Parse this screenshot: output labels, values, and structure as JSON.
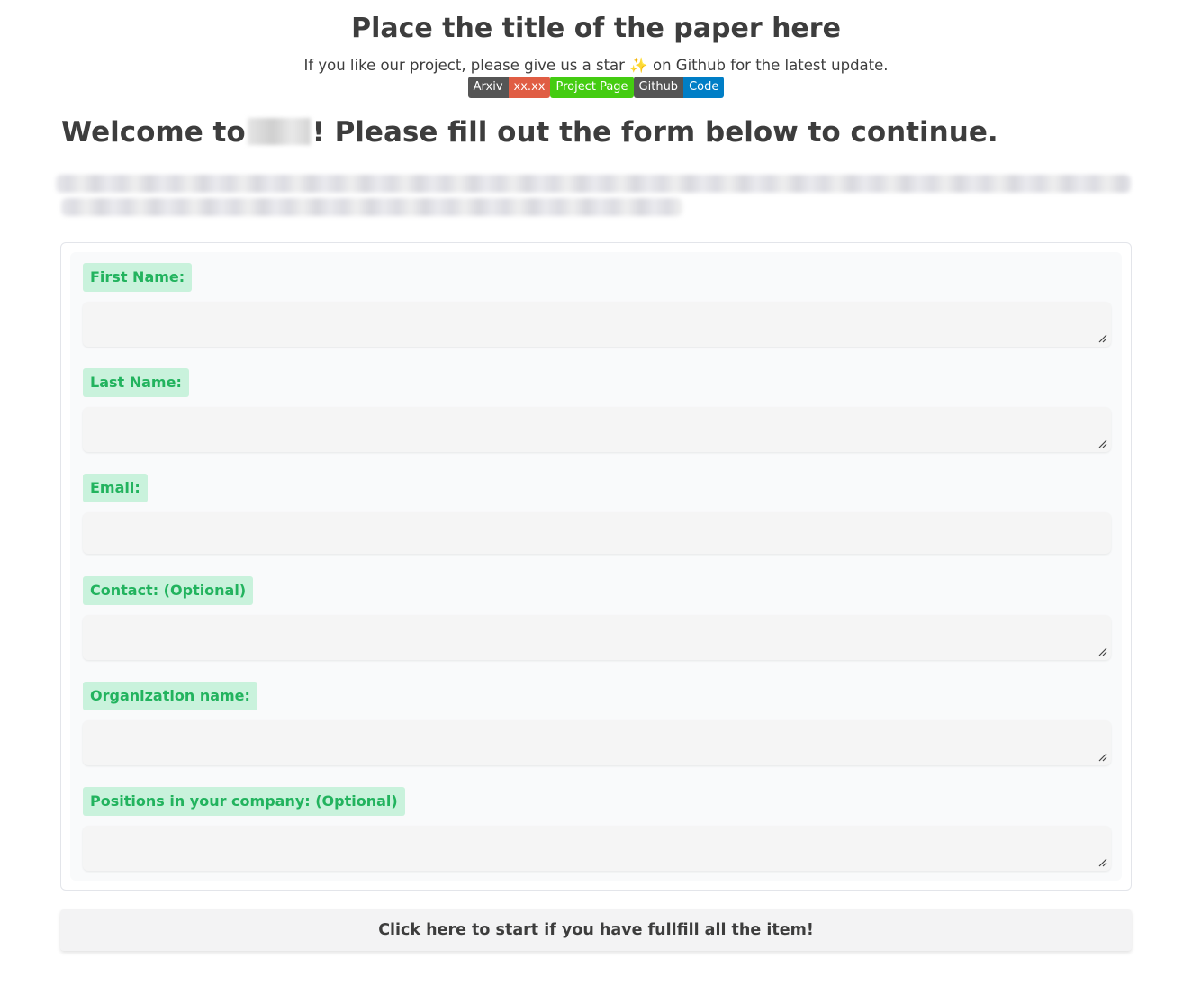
{
  "header": {
    "title": "Place the title of the paper here",
    "subtitle_before": "If you like our project, please give us a star",
    "star_glyph": "✨",
    "subtitle_after": "on Github for the latest update."
  },
  "badges": {
    "arxiv_label": "Arxiv",
    "arxiv_value": "xx.xx",
    "project_page": "Project Page",
    "github_label": "Github",
    "github_value": "Code"
  },
  "welcome": {
    "before": "Welcome to",
    "after": "! Please fill out the form below to continue."
  },
  "form": {
    "fields": [
      {
        "label": "First Name:",
        "value": ""
      },
      {
        "label": "Last Name:",
        "value": ""
      },
      {
        "label": "Email:",
        "value": ""
      },
      {
        "label": "Contact: (Optional)",
        "value": ""
      },
      {
        "label": "Organization name:",
        "value": ""
      },
      {
        "label": "Positions in your company: (Optional)",
        "value": ""
      }
    ]
  },
  "start_button": {
    "label": "Click here to start if you have fullfill all the item!"
  },
  "colors": {
    "label_bg": "#c9f2dc",
    "label_text": "#22b35e",
    "badge_dark": "#555555",
    "badge_red": "#e05d44",
    "badge_green": "#44cc11",
    "badge_blue": "#007ec6"
  }
}
